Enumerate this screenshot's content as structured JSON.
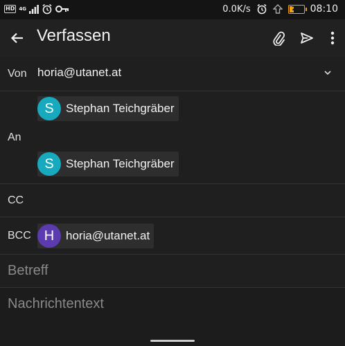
{
  "status": {
    "network_tag": "4G",
    "speed": "0.0K/s",
    "battery": "28",
    "battery_fraction": 0.28,
    "time": "08:10"
  },
  "app_bar": {
    "title": "Verfassen"
  },
  "compose": {
    "from_label": "Von",
    "from_value": "horia@utanet.at",
    "to_label": "An",
    "to_recipients": [
      {
        "initial": "S",
        "name": "Stephan Teichgräber",
        "color": "#17a9bd"
      },
      {
        "initial": "S",
        "name": "Stephan Teichgräber",
        "color": "#17a9bd"
      }
    ],
    "cc_label": "CC",
    "bcc_label": "BCC",
    "bcc_recipients": [
      {
        "initial": "H",
        "name": "horia@utanet.at",
        "color": "#5c3bb0"
      }
    ],
    "subject_placeholder": "Betreff",
    "body_placeholder": "Nachrichtentext"
  },
  "colors": {
    "accent_battery": "#f2a30f",
    "background": "#1c1c1c"
  }
}
